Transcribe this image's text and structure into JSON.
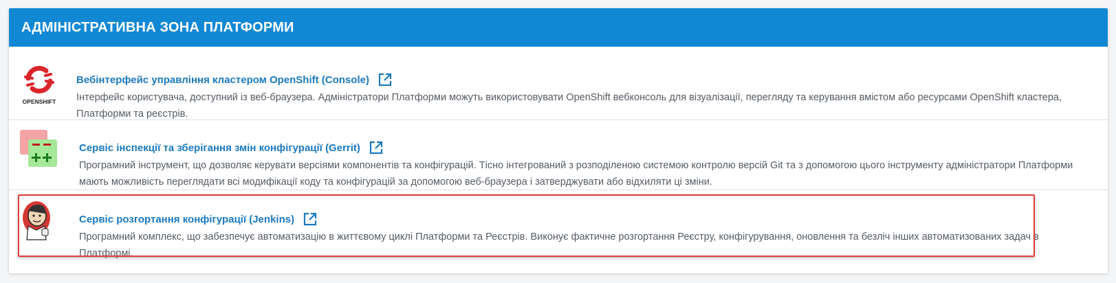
{
  "panel": {
    "header": "Адміністративна зона платформи"
  },
  "entries": [
    {
      "title": "Вебінтерфейс управління кластером OpenShift (Console)",
      "description": "Інтерфейс користувача, доступний із веб-браузера. Адміністратори Платформи можуть використовувати OpenShift вебконсоль для візуалізації, перегляду та керування вмістом або ресурсами OpenShift кластера, Платформи та реєстрів.",
      "logo_caption": "OPENSHIFT",
      "icon": "openshift-logo"
    },
    {
      "title": "Сервіс інспекції та зберігання змін конфігурації (Gerrit)",
      "description": "Програмний інструмент, що дозволяє керувати версіями компонентів та конфігурацій. Тісно інтегрований з розподіленою системою контролю версій Git та з допомогою цього інструменту адміністратори Платформи мають можливість переглядати всі модифікації коду та конфігурацій за допомогою веб-браузера і затверджувати або відхиляти ці зміни.",
      "icon": "gerrit-logo"
    },
    {
      "title": "Сервіс розгортання конфігурації (Jenkins)",
      "description": "Програмний комплекс, що забезпечує автоматизацію в життєвому циклі Платформи та Реєстрів. Виконує фактичне розгортання Реєстру, конфігурування, оновлення та безліч інших автоматизованих задач в Платформі.",
      "icon": "jenkins-logo",
      "highlighted": true
    }
  ],
  "colors": {
    "header_bg": "#1188d4",
    "link": "#1b79c0",
    "text": "#555b63",
    "highlight": "#e23b3b"
  },
  "icons": {
    "external_link": "external-link-icon"
  }
}
